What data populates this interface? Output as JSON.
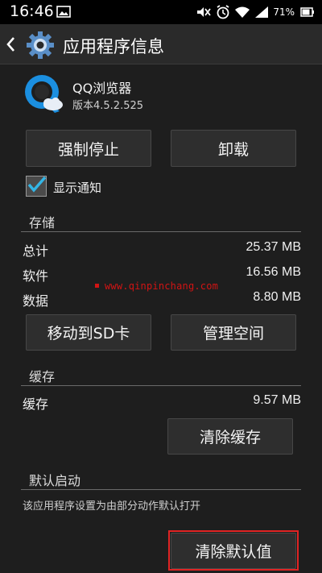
{
  "status_bar": {
    "time": "16:46",
    "battery_percent": "71%",
    "icons": [
      "image-icon",
      "mute-icon",
      "alarm-icon",
      "wifi-icon",
      "signal-icon",
      "battery-icon"
    ]
  },
  "action_bar": {
    "title": "应用程序信息"
  },
  "app": {
    "name": "QQ浏览器",
    "version": "版本4.5.2.525"
  },
  "buttons": {
    "force_stop": "强制停止",
    "uninstall": "卸载",
    "move_to_sd": "移动到SD卡",
    "manage_space": "管理空间",
    "clear_cache": "清除缓存",
    "clear_defaults": "清除默认值"
  },
  "notification": {
    "label": "显示通知",
    "checked": true
  },
  "storage": {
    "title": "存储",
    "rows": [
      {
        "label": "总计",
        "value": "25.37 MB"
      },
      {
        "label": "软件",
        "value": "16.56 MB"
      },
      {
        "label": "数据",
        "value": "8.80 MB"
      }
    ]
  },
  "cache": {
    "title": "缓存",
    "row": {
      "label": "缓存",
      "value": "9.57 MB"
    }
  },
  "default_launch": {
    "title": "默认启动",
    "description": "该应用程序设置为由部分动作默认打开"
  },
  "watermark": "www.qinpinchang.com",
  "colors": {
    "background": "#1e1e1e",
    "accent_check": "#33b5e5",
    "highlight": "#e02424",
    "watermark": "#d21414"
  }
}
